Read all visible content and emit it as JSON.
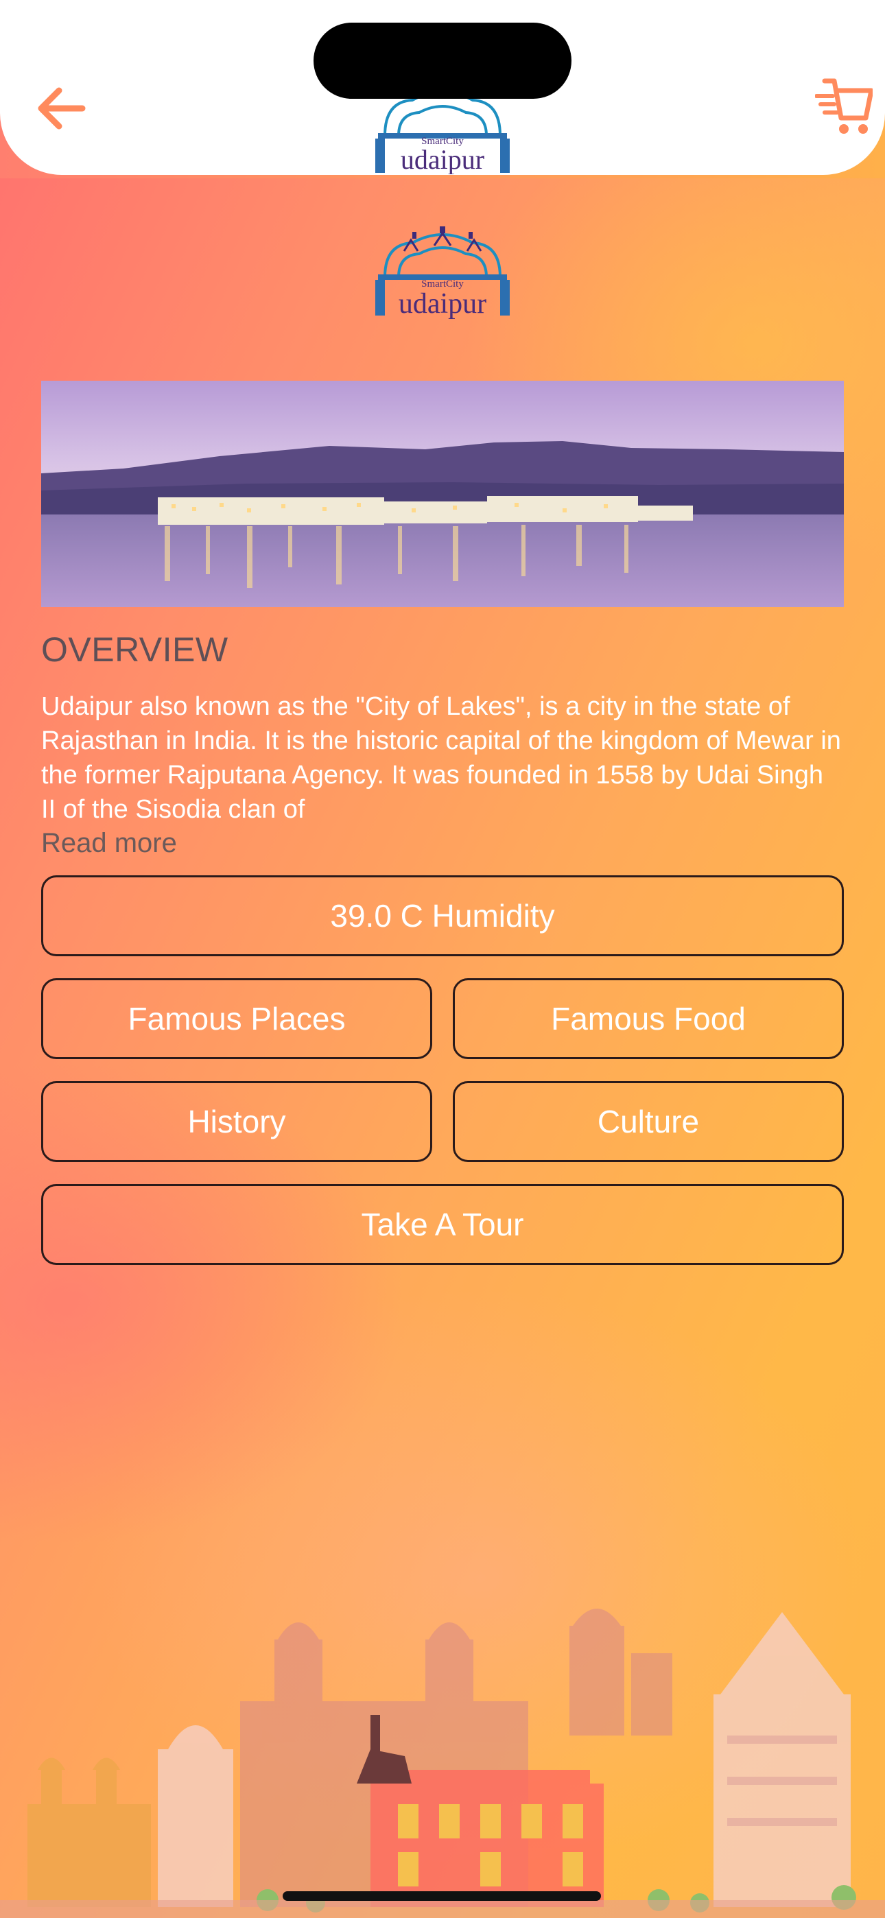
{
  "header": {
    "back_icon": "arrow-left-icon",
    "cart_icon": "shopping-cart-icon",
    "accent_color": "#ff8a5c"
  },
  "logo": {
    "line1": "SmartCity",
    "line2": "udaipur"
  },
  "overview": {
    "title": "OVERVIEW",
    "text": "Udaipur also known as the \"City of Lakes\", is a city in the state of Rajasthan in India. It is the historic capital of the kingdom of Mewar in the former Rajputana Agency. It was founded in 1558 by Udai Singh II of the Sisodia clan of",
    "read_more": "Read more"
  },
  "buttons": {
    "weather": "39.0 C Humidity",
    "famous_places": "Famous Places",
    "famous_food": "Famous Food",
    "history": "History",
    "culture": "Culture",
    "tour": "Take A Tour"
  }
}
